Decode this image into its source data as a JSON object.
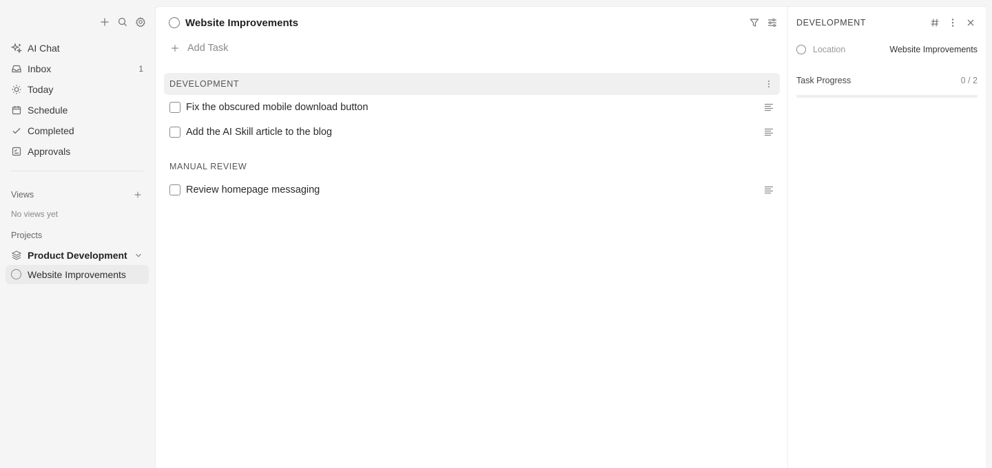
{
  "sidebar": {
    "toolbar": {
      "icons": [
        "plus-icon",
        "search-icon",
        "gear-icon"
      ]
    },
    "nav": [
      {
        "label": "AI Chat",
        "icon": "sparkles-icon",
        "count": ""
      },
      {
        "label": "Inbox",
        "icon": "inbox-icon",
        "count": "1"
      },
      {
        "label": "Today",
        "icon": "sun-icon",
        "count": ""
      },
      {
        "label": "Schedule",
        "icon": "calendar-icon",
        "count": ""
      },
      {
        "label": "Completed",
        "icon": "check-icon",
        "count": ""
      },
      {
        "label": "Approvals",
        "icon": "approval-icon",
        "count": ""
      }
    ],
    "views": {
      "heading": "Views",
      "empty": "No views yet"
    },
    "projects": {
      "heading": "Projects",
      "group": "Product Development",
      "active": "Website Improvements"
    }
  },
  "main": {
    "title": "Website Improvements",
    "add_task": "Add Task",
    "sections": [
      {
        "name": "DEVELOPMENT",
        "tasks": [
          "Fix the obscured mobile download button",
          "Add the AI Skill article to the blog"
        ]
      },
      {
        "name": "MANUAL REVIEW",
        "tasks": [
          "Review homepage messaging"
        ]
      }
    ]
  },
  "panel": {
    "title": "DEVELOPMENT",
    "location_label": "Location",
    "location_value": "Website Improvements",
    "progress_label": "Task Progress",
    "progress_value": "0 / 2",
    "progress_fraction": 0
  },
  "colors": {
    "accent": "#4c8bf5",
    "sidebar_bg": "#f5f5f5",
    "active_bg": "#ebebeb"
  }
}
